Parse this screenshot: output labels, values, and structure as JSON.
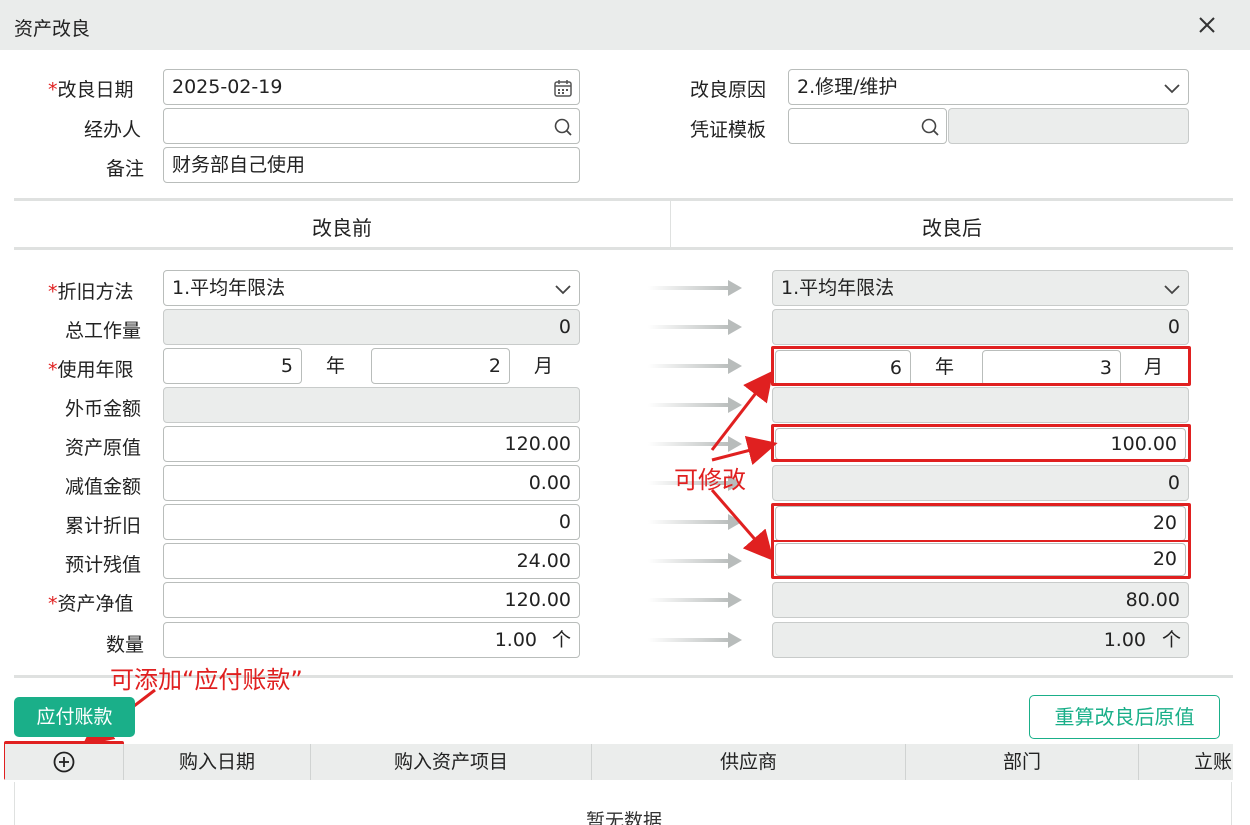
{
  "window": {
    "title": "资产改良",
    "close_label": "close"
  },
  "header_form": {
    "improve_date": {
      "label": "改良日期",
      "value": "2025-02-19"
    },
    "handler": {
      "label": "经办人",
      "value": ""
    },
    "remark": {
      "label": "备注",
      "value": "财务部自己使用"
    },
    "reason": {
      "label": "改良原因",
      "value": "2.修理/维护"
    },
    "voucher_template": {
      "label": "凭证模板",
      "value": "",
      "extra": ""
    }
  },
  "sections": {
    "before": "改良前",
    "after": "改良后"
  },
  "rows": {
    "depreciation_method": {
      "label": "折旧方法",
      "before": "1.平均年限法",
      "after": "1.平均年限法"
    },
    "total_workload": {
      "label": "总工作量",
      "before": "0",
      "after": "0"
    },
    "useful_life": {
      "label": "使用年限",
      "before_years": "5",
      "before_months": "2",
      "after_years": "6",
      "after_months": "3",
      "year_unit": "年",
      "month_unit": "月"
    },
    "fx_amount": {
      "label": "外币金额",
      "before": "",
      "after": ""
    },
    "original_value": {
      "label": "资产原值",
      "before": "120.00",
      "after": "100.00"
    },
    "impairment": {
      "label": "减值金额",
      "before": "0.00",
      "after": "0"
    },
    "accum_depreciation": {
      "label": "累计折旧",
      "before": "0",
      "after": "20"
    },
    "residual_value": {
      "label": "预计残值",
      "before": "24.00",
      "after": "20"
    },
    "net_value": {
      "label": "资产净值",
      "before": "120.00",
      "after": "80.00"
    },
    "quantity": {
      "label": "数量",
      "before": "1.00",
      "after": "1.00",
      "unit": "个"
    }
  },
  "annotations": {
    "editable": "可修改",
    "can_add": "可添加“应付账款”"
  },
  "buttons": {
    "payables": "应付账款",
    "recalc": "重算改良后原值"
  },
  "table": {
    "columns": [
      "购入日期",
      "购入资产项目",
      "供应商",
      "部门",
      "立账"
    ],
    "empty_text": "暂无数据"
  },
  "colors": {
    "accent": "#1aaf89",
    "annotation_red": "#e02020",
    "readonly_bg": "#ebedec"
  }
}
